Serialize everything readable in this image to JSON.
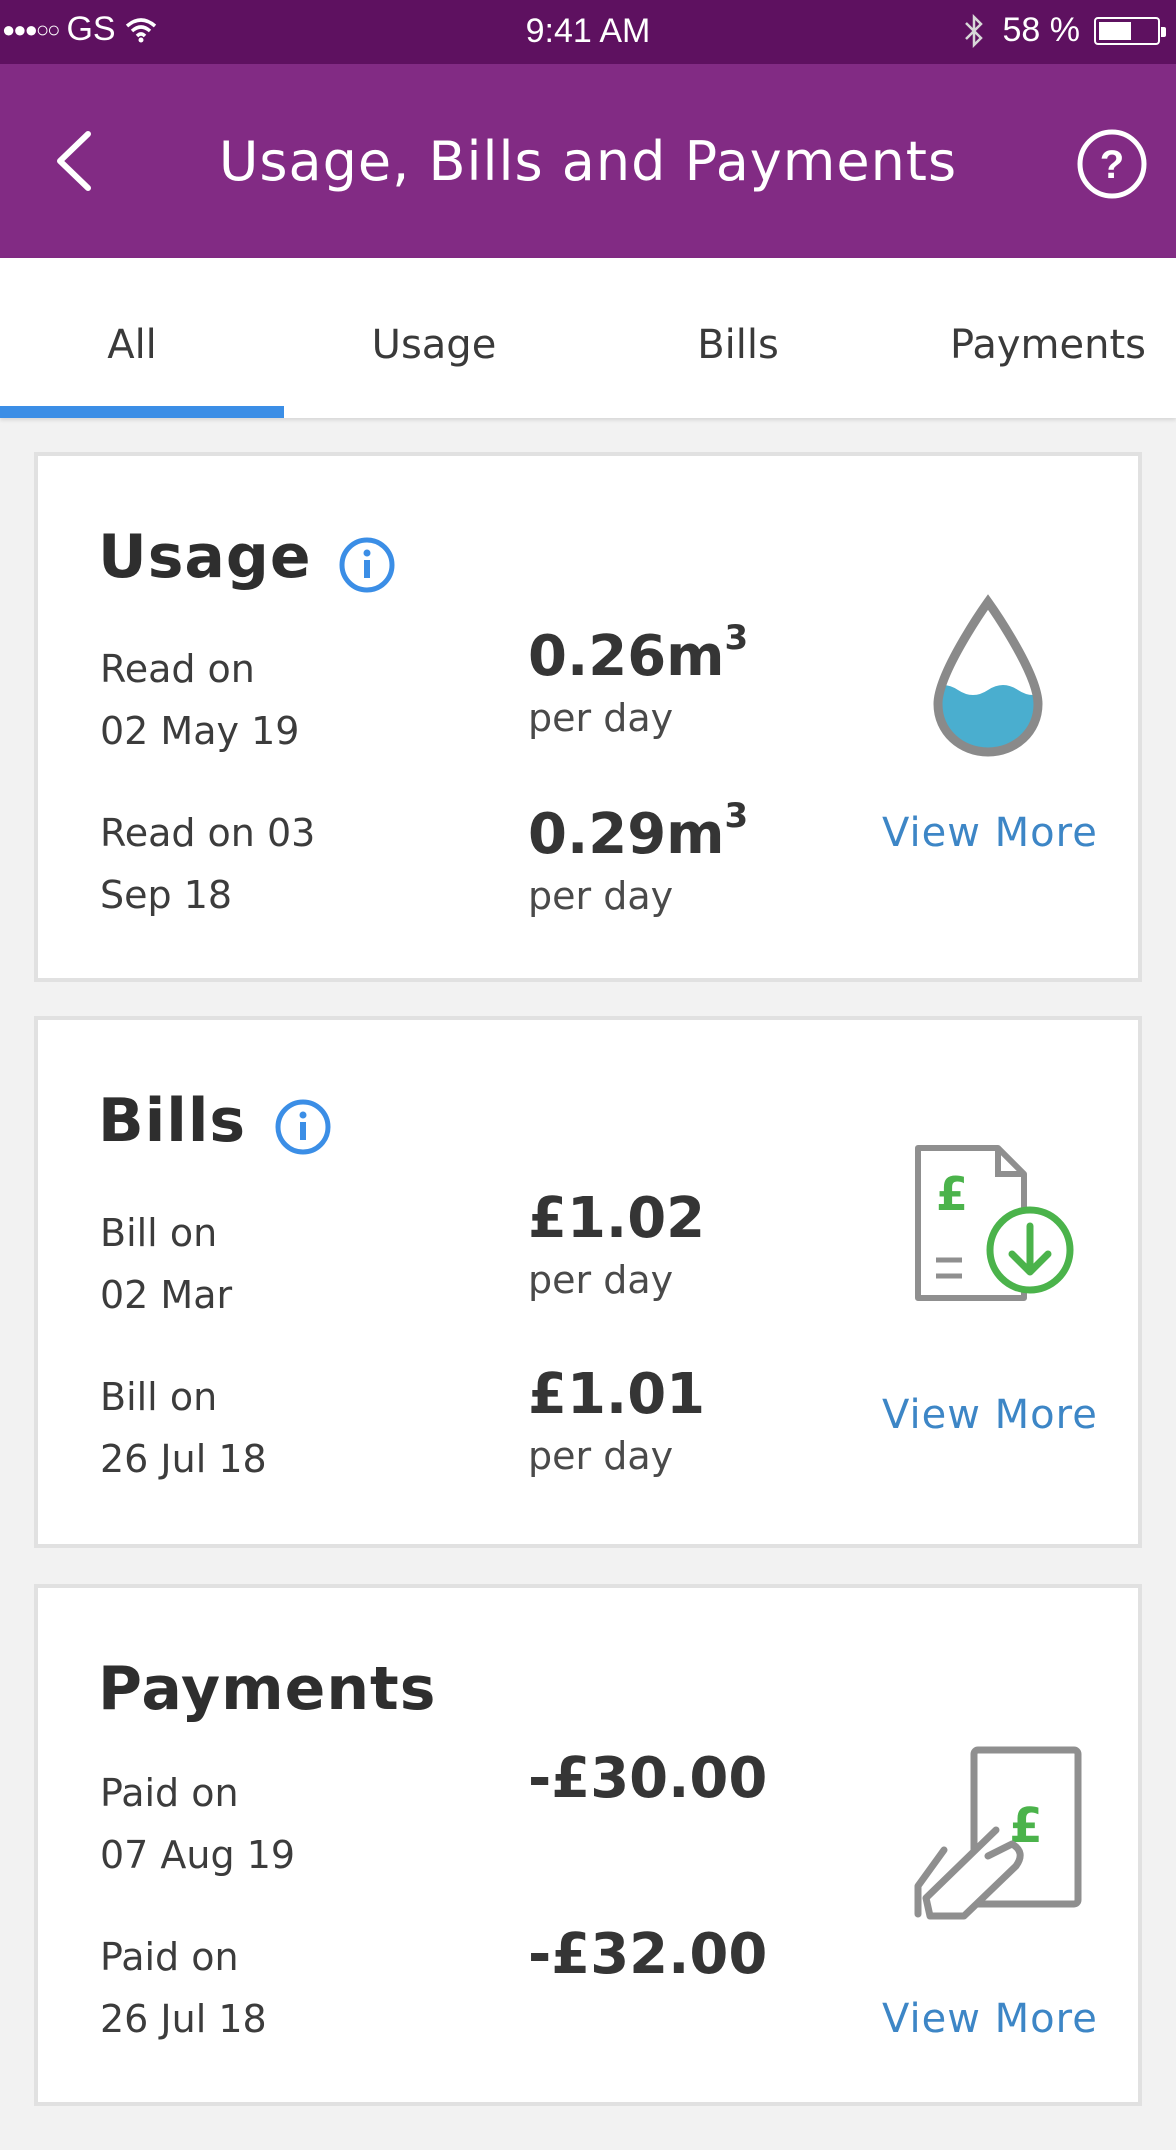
{
  "status_bar": {
    "signal_dots": "●●●○○",
    "carrier": "GS",
    "time": "9:41 AM",
    "battery": "58 %",
    "battery_level": 0.58
  },
  "header": {
    "title": "Usage, Bills and Payments",
    "back_icon": "chevron-left-icon",
    "help_icon": "question-circle-icon"
  },
  "tabs": [
    {
      "label": "All",
      "selected": true
    },
    {
      "label": "Usage",
      "selected": false
    },
    {
      "label": "Bills",
      "selected": false
    },
    {
      "label": "Payments",
      "selected": false
    }
  ],
  "accent_color": "#3b8ee6",
  "header_color": "#822b84",
  "usage": {
    "title": "Usage",
    "rows": [
      {
        "label_line1": "Read on",
        "label_line2": "02 May 19",
        "value": "0.26m",
        "superscript": "3",
        "unit": "per day"
      },
      {
        "label_line1": "Read on 03",
        "label_line2": "Sep 18",
        "value": "0.29m",
        "superscript": "3",
        "unit": "per day"
      }
    ],
    "view_more": "View More",
    "icon": "water-drop-icon"
  },
  "bills": {
    "title": "Bills",
    "rows": [
      {
        "label_line1": "Bill on",
        "label_line2": "02 Mar",
        "value": "£1.02",
        "unit": "per day"
      },
      {
        "label_line1": "Bill on",
        "label_line2": "26 Jul 18",
        "value": "£1.01",
        "unit": "per day"
      }
    ],
    "view_more": "View More",
    "icon": "bill-download-icon",
    "icon_symbol": "£"
  },
  "payments": {
    "title": "Payments",
    "rows": [
      {
        "label_line1": "Paid on",
        "label_line2": "07 Aug 19",
        "value": "-£30.00"
      },
      {
        "label_line1": "Paid on",
        "label_line2": "26 Jul 18",
        "value": "-£32.00"
      }
    ],
    "view_more": "View More",
    "icon": "hand-payment-icon",
    "icon_symbol": "£"
  }
}
